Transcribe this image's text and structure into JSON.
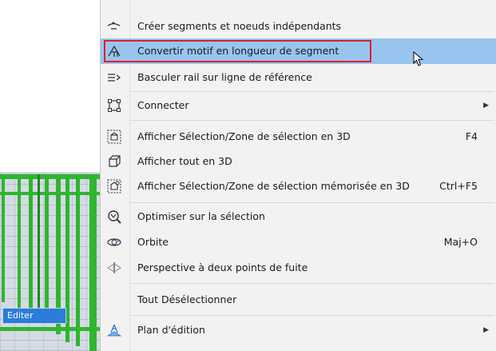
{
  "menu": {
    "items": [
      {
        "icon": "split-segments-icon",
        "label": "Créer segments et noeuds indépendants",
        "shortcut": "",
        "submenu": false
      },
      {
        "icon": "convert-pattern-icon",
        "label": "Convertir motif en longueur de segment",
        "shortcut": "",
        "submenu": false,
        "highlighted": true
      },
      {
        "icon": "toggle-rail-icon",
        "label": "Basculer rail sur ligne de référence",
        "shortcut": "",
        "submenu": false
      },
      {
        "icon": "connect-icon",
        "label": "Connecter",
        "shortcut": "",
        "submenu": true
      },
      {
        "icon": "show-selection-3d-icon",
        "label": "Afficher Sélection/Zone de sélection en 3D",
        "shortcut": "F4",
        "submenu": false
      },
      {
        "icon": "show-all-3d-icon",
        "label": "Afficher tout en 3D",
        "shortcut": "",
        "submenu": false
      },
      {
        "icon": "show-saved-selection-3d-icon",
        "label": "Afficher Sélection/Zone de sélection mémorisée en 3D",
        "shortcut": "Ctrl+F5",
        "submenu": false
      },
      {
        "icon": "optimize-selection-icon",
        "label": "Optimiser sur la sélection",
        "shortcut": "",
        "submenu": false
      },
      {
        "icon": "orbit-icon",
        "label": "Orbite",
        "shortcut": "Maj+O",
        "submenu": false
      },
      {
        "icon": "two-point-perspective-icon",
        "label": "Perspective à deux points de fuite",
        "shortcut": "",
        "submenu": false
      },
      {
        "icon": "",
        "label": "Tout Désélectionner",
        "shortcut": "",
        "submenu": false
      },
      {
        "icon": "edit-plane-icon",
        "label": "Plan d'édition",
        "shortcut": "",
        "submenu": true
      }
    ]
  },
  "viewport": {
    "edit_label": "Editer"
  },
  "colors": {
    "highlight": "#98c5f0",
    "highlight_outline": "#e02020",
    "rail_green": "#2fb52f",
    "menu_bg": "#f2f2f2"
  }
}
